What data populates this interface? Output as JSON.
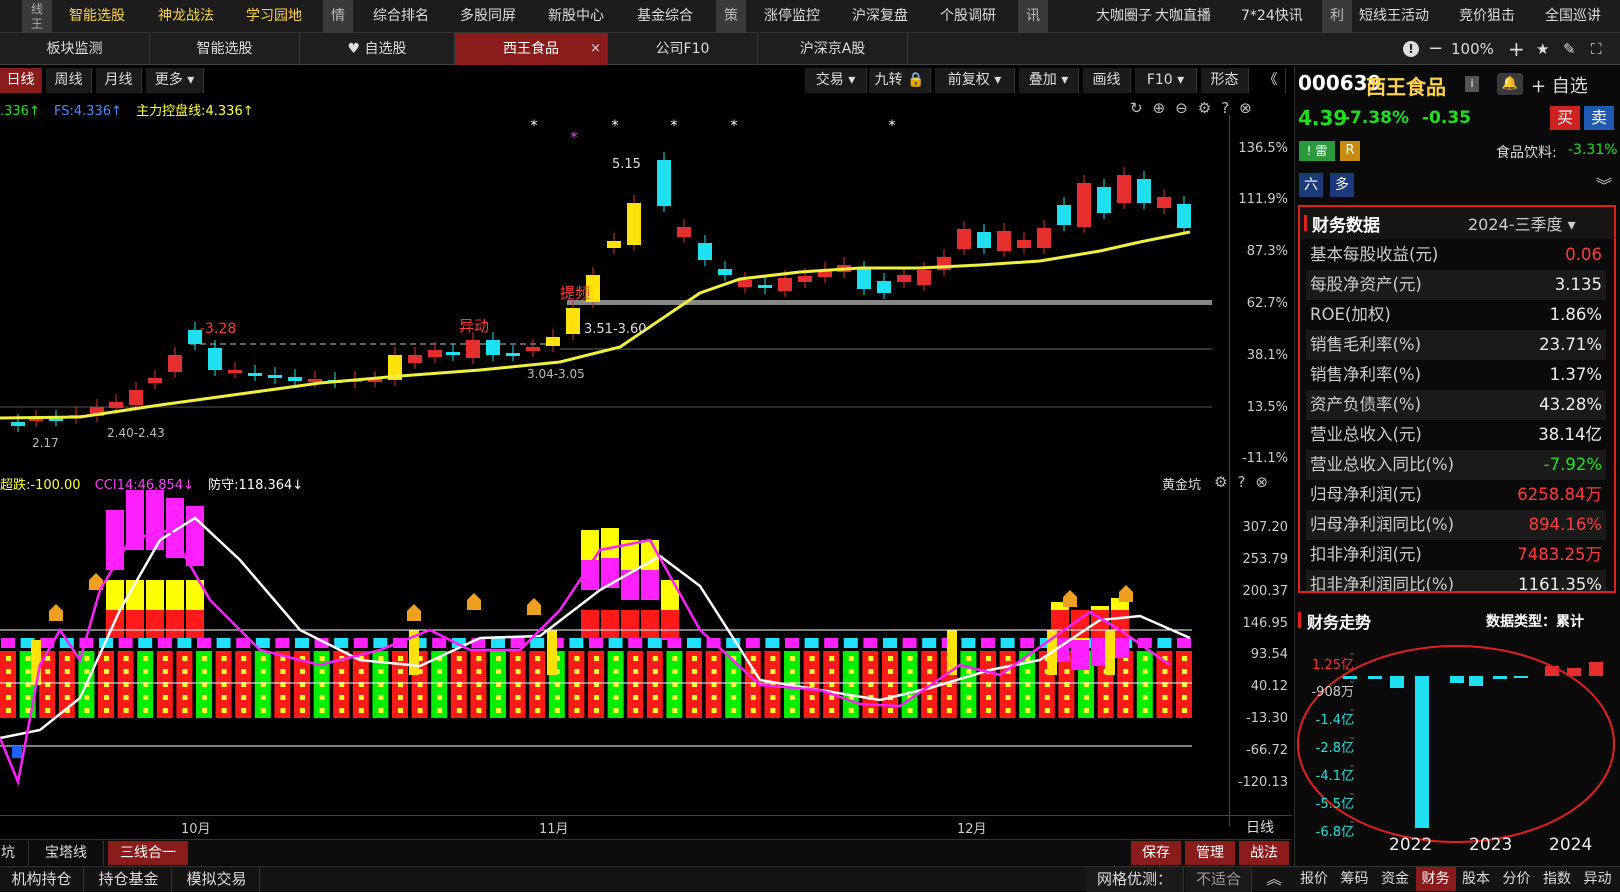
{
  "topnav": {
    "left_stub": "线\n王",
    "items": [
      "智能选股",
      "神龙战法",
      "学习园地"
    ],
    "groups": [
      {
        "tag": "情",
        "items": [
          "综合排名",
          "多股同屏",
          "新股中心",
          "基金综合"
        ]
      },
      {
        "tag": "策",
        "items": [
          "涨停监控",
          "沪深复盘",
          "个股调研"
        ]
      },
      {
        "tag": "讯",
        "items": [
          "大咖圈子",
          "大咖直播",
          "7*24快讯"
        ]
      },
      {
        "tag": "利",
        "items": [
          "短线王活动",
          "竞价狙击",
          "全国巡讲"
        ]
      }
    ]
  },
  "tabs": {
    "items": [
      "板块监测",
      "智能选股",
      "♥ 自选股",
      "西王食品",
      "公司F10",
      "沪深京A股"
    ],
    "active_index": 3,
    "close": "×"
  },
  "controls": {
    "zoom": "100%",
    "info": "!",
    "minus": "−",
    "plus": "+",
    "star": "★",
    "edit": "✎",
    "expand": "⛶"
  },
  "period": {
    "items": [
      "日线",
      "周线",
      "月线",
      "更多 ▾"
    ],
    "active_index": 0
  },
  "chart_tools": [
    "交易 ▾",
    "九转 🔒",
    "前复权 ▾",
    "叠加 ▾",
    "画线",
    "F10 ▾",
    "形态",
    "《"
  ],
  "main_legend": [
    {
      "text": ".336↑",
      "color": "#1ee01e"
    },
    {
      "text": "FS:4.336↑",
      "color": "#4a8cff"
    },
    {
      "text": "主力控盘线:4.336↑",
      "color": "#ffff40"
    }
  ],
  "price_axis": [
    "136.5%",
    "111.9%",
    "87.3%",
    "62.7%",
    "38.1%",
    "13.5%",
    "-11.1%"
  ],
  "annotations": {
    "low": "2.17",
    "range1": "2.40-2.43",
    "range2": "3.04-3.05",
    "range3": "3.51-3.60",
    "high": "5.15",
    "pct": "-3.28",
    "tag1": "异动",
    "tag2": "提频"
  },
  "ind_legend": [
    {
      "text": "超跌:-100.00",
      "color": "#ffff40"
    },
    {
      "text": "CCI14:46.854↓",
      "color": "#ff40ff"
    },
    {
      "text": "防守:118.364↓",
      "color": "#ffffff"
    }
  ],
  "ind_title": "黄金坑",
  "ind_axis": [
    "307.20",
    "253.79",
    "200.37",
    "146.95",
    "93.54",
    "40.12",
    "-13.30",
    "-66.72",
    "-120.13"
  ],
  "time_axis": [
    "10月",
    "11月",
    "12月"
  ],
  "time_mode": "日线",
  "bottom_tabs": {
    "items": [
      "坑",
      "宝塔线",
      "三线合一"
    ],
    "active_index": 2,
    "right": [
      "保存",
      "管理",
      "战法"
    ]
  },
  "status_bar": {
    "items": [
      "机构持仓",
      "持仓基金",
      "模拟交易"
    ],
    "grid_label": "网格优测：",
    "grid_value": "不适合",
    "up": "︽"
  },
  "stock": {
    "code": "000639",
    "name": "西王食品",
    "badge": "i",
    "bell": "🔔",
    "add": "+ 自选",
    "price": "4.39",
    "pct": "-7.38%",
    "chg": "-0.35",
    "buy": "买",
    "sell": "卖",
    "tags": [
      "雷",
      "R"
    ],
    "sector": "食品饮料:",
    "sector_pct": "-3.31%",
    "views": [
      "六",
      "多"
    ]
  },
  "financial": {
    "title": "财务数据",
    "period": "2024-三季度 ▾",
    "rows": [
      {
        "k": "基本每股收益(元)",
        "v": "0.06",
        "c": "r"
      },
      {
        "k": "每股净资产(元)",
        "v": "3.135",
        "c": ""
      },
      {
        "k": "ROE(加权)",
        "v": "1.86%",
        "c": ""
      },
      {
        "k": "销售毛利率(%)",
        "v": "23.71%",
        "c": ""
      },
      {
        "k": "销售净利率(%)",
        "v": "1.37%",
        "c": ""
      },
      {
        "k": "资产负债率(%)",
        "v": "43.28%",
        "c": ""
      },
      {
        "k": "营业总收入(元)",
        "v": "38.14亿",
        "c": ""
      },
      {
        "k": "营业总收入同比(%)",
        "v": "-7.92%",
        "c": "g"
      },
      {
        "k": "归母净利润(元)",
        "v": "6258.84万",
        "c": "r"
      },
      {
        "k": "归母净利润同比(%)",
        "v": "894.16%",
        "c": "r"
      },
      {
        "k": "扣非净利润(元)",
        "v": "7483.25万",
        "c": "r"
      },
      {
        "k": "扣非净利润同比(%)",
        "v": "1161.35%",
        "c": ""
      }
    ]
  },
  "trend": {
    "title": "财务走势",
    "type_label": "数据类型：累计",
    "axis": [
      "1.25亿",
      "-908万",
      "-1.4亿",
      "-2.8亿",
      "-4.1亿",
      "-5.5亿",
      "-6.8亿"
    ],
    "years": [
      "2022",
      "2023",
      "2024"
    ]
  },
  "right_tabs": [
    "报价",
    "筹码",
    "资金",
    "财务",
    "股本",
    "分价",
    "指数",
    "异动"
  ],
  "right_tabs_active": 3,
  "colors": {
    "up": "#ff3b3b",
    "down": "#1ee0e0",
    "ma": "#ffff40",
    "magenta": "#ff20ff",
    "yellow": "#ffff00",
    "green": "#00ff00",
    "cyan": "#20e0ff"
  }
}
